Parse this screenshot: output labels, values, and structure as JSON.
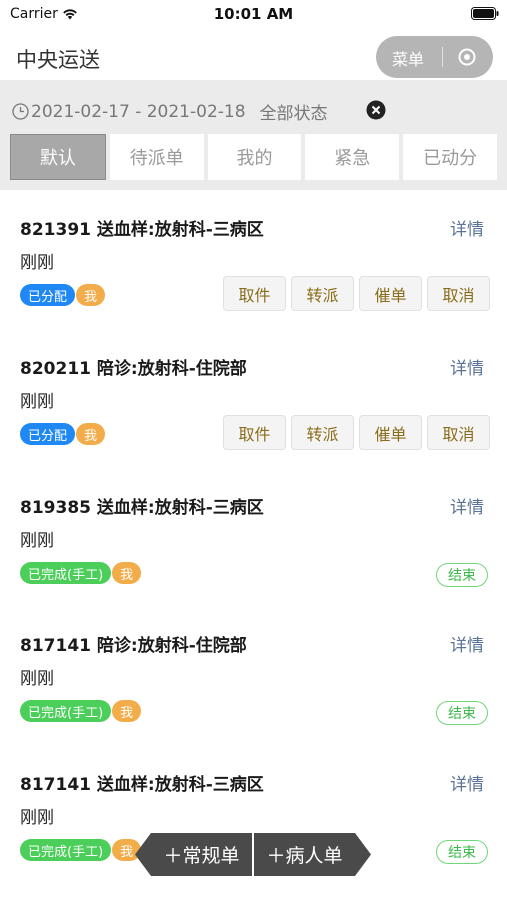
{
  "status_bar": {
    "carrier": "Carrier",
    "time": "10:01 AM"
  },
  "header": {
    "title": "中央运送",
    "menu_label": "菜单"
  },
  "filter": {
    "date_range": "2021-02-17 - 2021-02-18",
    "status": "全部状态"
  },
  "tabs": [
    {
      "label": "默认",
      "active": true
    },
    {
      "label": "待派单",
      "active": false
    },
    {
      "label": "我的",
      "active": false
    },
    {
      "label": "紧急",
      "active": false
    },
    {
      "label": "已动分",
      "active": false
    }
  ],
  "orders": [
    {
      "title": "821391 送血样:放射科-三病区",
      "time": "刚刚",
      "detail": "详情",
      "status_badge": "已分配",
      "owner_badge": "我",
      "actions": [
        "取件",
        "转派",
        "催单",
        "取消"
      ]
    },
    {
      "title": "820211 陪诊:放射科-住院部",
      "time": "刚刚",
      "detail": "详情",
      "status_badge": "已分配",
      "owner_badge": "我",
      "actions": [
        "取件",
        "转派",
        "催单",
        "取消"
      ]
    },
    {
      "title": "819385 送血样:放射科-三病区",
      "time": "刚刚",
      "detail": "详情",
      "status_badge": "已完成(手工)",
      "owner_badge": "我",
      "end_tag": "结束"
    },
    {
      "title": "817141 陪诊:放射科-住院部",
      "time": "刚刚",
      "detail": "详情",
      "status_badge": "已完成(手工)",
      "owner_badge": "我",
      "end_tag": "结束"
    },
    {
      "title": "817141 送血样:放射科-三病区",
      "time": "刚刚",
      "detail": "详情",
      "status_badge": "已完成(手工)",
      "owner_badge": "我",
      "end_tag": "结束"
    }
  ],
  "floating": {
    "regular_order": "＋常规单",
    "patient_order": "＋病人单"
  },
  "colors": {
    "badge_assigned": "#1f88f5",
    "badge_done": "#4ccf5a",
    "badge_owner": "#f2ad4a",
    "detail_link": "#5a7396",
    "action_text": "#8a6d1a"
  }
}
